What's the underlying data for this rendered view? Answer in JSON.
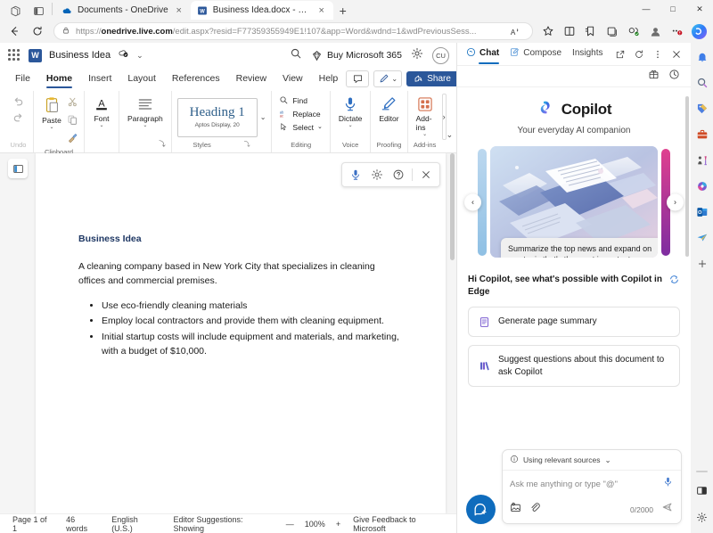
{
  "browser": {
    "window_icons": [
      "workspaces-icon",
      "tab-actions-icon"
    ],
    "tabs": [
      {
        "title": "Documents - OneDrive",
        "favicon": "onedrive-icon",
        "active": false,
        "close": "×"
      },
      {
        "title": "Business Idea.docx - Microsoft W",
        "favicon": "word-icon",
        "active": true,
        "close": "×"
      }
    ],
    "new_tab_label": "+",
    "window_controls": {
      "minimize": "—",
      "maximize": "□",
      "close": "✕"
    },
    "nav": {
      "back": "←",
      "refresh": "↻"
    },
    "address": {
      "lock_icon": "lock-icon",
      "url_prefix": "https://",
      "url_domain": "onedrive.live.com",
      "url_suffix": "/edit.aspx?resid=F77359355949E1!107&app=Word&wdnd=1&wdPreviousSess...",
      "read_aloud_icon": "read-aloud-icon"
    },
    "toolbar_icons": [
      "favorites-star-icon",
      "split-screen-icon",
      "favorites-list-icon",
      "collections-icon",
      "browser-essentials-icon",
      "profile-icon",
      "settings-more-icon",
      "copilot-icon"
    ]
  },
  "word": {
    "header": {
      "app_launcher_icon": "app-launcher-icon",
      "app_icon": "word-icon",
      "doc_title": "Business Idea",
      "autosave_icon": "saved-to-cloud-icon",
      "title_chevron": "⌄",
      "search_icon": "search-icon",
      "buy_label": "Buy Microsoft 365",
      "buy_icon": "diamond-icon",
      "settings_icon": "gear-icon",
      "avatar_initials": "CU"
    },
    "tabs": [
      {
        "label": "File",
        "active": false
      },
      {
        "label": "Home",
        "active": true
      },
      {
        "label": "Insert",
        "active": false
      },
      {
        "label": "Layout",
        "active": false
      },
      {
        "label": "References",
        "active": false
      },
      {
        "label": "Review",
        "active": false
      },
      {
        "label": "View",
        "active": false
      },
      {
        "label": "Help",
        "active": false
      }
    ],
    "tab_actions": {
      "comments_icon": "comment-icon",
      "editing_icon": "pen-icon",
      "editing_chevron": "⌄",
      "share_label": "Share",
      "share_icon": "share-icon",
      "share_chevron": "⌄"
    },
    "ribbon": {
      "groups": [
        {
          "label": "Undo",
          "buttons": [
            {
              "name": "undo",
              "label": "",
              "icon": "undo-icon"
            },
            {
              "name": "redo",
              "label": "",
              "icon": "redo-icon"
            }
          ]
        },
        {
          "label": "Clipboard",
          "buttons": [
            {
              "name": "paste",
              "label": "Paste",
              "icon": "paste-icon",
              "chevron": "⌄"
            },
            {
              "name": "cut",
              "label": "",
              "icon": "scissors-icon"
            },
            {
              "name": "copy",
              "label": "",
              "icon": "copy-icon"
            },
            {
              "name": "format-painter",
              "label": "",
              "icon": "format-painter-icon"
            }
          ]
        },
        {
          "label": "",
          "buttons": [
            {
              "name": "font",
              "label": "Font",
              "icon": "font-icon",
              "chevron": "⌄"
            }
          ]
        },
        {
          "label": "",
          "dialog_launcher": "⤵",
          "buttons": [
            {
              "name": "paragraph",
              "label": "Paragraph",
              "icon": "paragraph-icon",
              "chevron": "⌄"
            }
          ]
        },
        {
          "label": "Styles",
          "dialog_launcher": "⤵",
          "style_gallery": {
            "name": "Heading 1",
            "font_info": "Aptos Display, 20",
            "chevron": "⌄"
          }
        },
        {
          "label": "Editing",
          "small_buttons": [
            {
              "name": "find",
              "label": "Find",
              "icon": "search-icon"
            },
            {
              "name": "replace",
              "label": "Replace",
              "icon": "replace-icon"
            },
            {
              "name": "select",
              "label": "Select",
              "icon": "select-icon",
              "chevron": "⌄"
            }
          ]
        },
        {
          "label": "Voice",
          "buttons": [
            {
              "name": "dictate",
              "label": "Dictate",
              "icon": "microphone-icon",
              "chevron": "⌄"
            }
          ]
        },
        {
          "label": "Proofing",
          "buttons": [
            {
              "name": "editor",
              "label": "Editor",
              "icon": "editor-pen-icon"
            }
          ]
        },
        {
          "label": "Add-ins",
          "buttons": [
            {
              "name": "add-ins",
              "label": "Add-ins",
              "icon": "addins-grid-icon",
              "chevron": "⌄"
            }
          ]
        }
      ],
      "more_button": "›",
      "collapse_button": "⌄"
    },
    "document": {
      "gutter_icon": "navigation-pane-icon",
      "heading": "Business Idea",
      "paragraph": "A cleaning company based in New York City that specializes in cleaning offices and commercial premises.",
      "bullets": [
        "Use eco-friendly cleaning materials",
        "Employ local contractors and provide them with cleaning equipment.",
        "Initial startup costs will include equipment and materials, and marketing, with a budget of $10,000."
      ],
      "heading_color": "#1f3864"
    },
    "float_toolbar": {
      "icons": [
        "microphone-icon",
        "gear-icon",
        "help-icon",
        "close-icon"
      ]
    },
    "statusbar": {
      "page": "Page 1 of 1",
      "words": "46 words",
      "language": "English (U.S.)",
      "editor": "Editor Suggestions: Showing",
      "zoom_out": "—",
      "zoom_level": "100%",
      "zoom_in": "+",
      "feedback": "Give Feedback to Microsoft"
    }
  },
  "copilot": {
    "tabs": [
      {
        "label": "Chat",
        "icon": "chat-icon",
        "active": true
      },
      {
        "label": "Compose",
        "icon": "compose-icon",
        "active": false
      },
      {
        "label": "Insights",
        "icon": "",
        "active": false
      }
    ],
    "header_actions": [
      "open-in-new-icon",
      "refresh-icon",
      "more-options-icon",
      "close-icon"
    ],
    "subbar_actions": [
      "plugins-icon",
      "history-icon"
    ],
    "brand": {
      "name": "Copilot",
      "logo": "copilot-logo-icon"
    },
    "tagline": "Your everyday AI companion",
    "carousel": {
      "prev": "‹",
      "next": "›",
      "card_prompt": "Summarize the top news and expand on one topic that's the most important"
    },
    "greeting": "Hi Copilot, see what's possible with Copilot in Edge",
    "refresh_icon": "refresh-suggestions-icon",
    "suggestions": [
      {
        "label": "Generate page summary",
        "icon": "summary-icon"
      },
      {
        "label": "Suggest questions about this document to ask Copilot",
        "icon": "questions-icon"
      }
    ],
    "input": {
      "new_chat_icon": "new-chat-icon",
      "source_label": "Using relevant sources",
      "source_info_icon": "info-icon",
      "source_chevron": "⌄",
      "placeholder": "Ask me anything or type \"@\"",
      "mic_icon": "microphone-icon",
      "image_icon": "add-image-icon",
      "attach_icon": "attach-icon",
      "char_count": "0/2000",
      "send_icon": "send-icon"
    }
  },
  "edge_sidebar": {
    "icons": [
      "notifications-icon",
      "search-icon",
      "shopping-icon",
      "tools-icon",
      "games-icon",
      "image-creator-icon",
      "outlook-icon",
      "send-icon",
      "add-icon"
    ],
    "bottom_icons": [
      "split-screen-icon",
      "sidebar-settings-icon"
    ]
  },
  "colors": {
    "word_blue": "#2b579a",
    "copilot_blue": "#0f6cbd",
    "accent": "#0078d4"
  }
}
